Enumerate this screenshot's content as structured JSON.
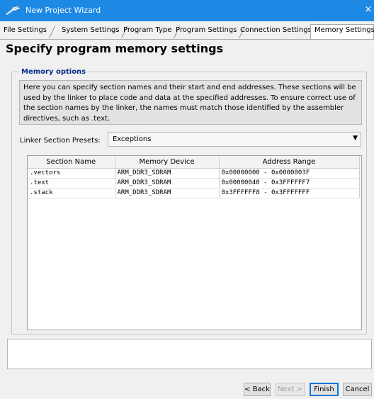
{
  "window": {
    "title": "New Project Wizard",
    "close_glyph": "×",
    "icon": "eclipse-wand-icon"
  },
  "tabs": [
    {
      "label": "File Settings",
      "active": false
    },
    {
      "label": "System Settings",
      "active": false
    },
    {
      "label": "Program Type",
      "active": false
    },
    {
      "label": "Program Settings",
      "active": false
    },
    {
      "label": "Connection Settings",
      "active": false
    },
    {
      "label": "Memory Settings",
      "active": true
    }
  ],
  "page": {
    "title": "Specify program memory settings"
  },
  "memory_options": {
    "legend": "Memory options",
    "description": "Here you can specify section names and their start and end addresses. These sections will be used by the linker to place code and data at the specified addresses. To ensure correct use of the section names by the linker, the names must match those identified by the assembler directives, such as .text.",
    "presets_label": "Linker Section Presets:",
    "presets_value": "Exceptions"
  },
  "table": {
    "columns": [
      "Section Name",
      "Memory Device",
      "Address Range"
    ],
    "rows": [
      {
        "section": ".vectors",
        "device": "ARM_DDR3_SDRAM",
        "range": "0x00000000 - 0x0000003F"
      },
      {
        "section": ".text",
        "device": "ARM_DDR3_SDRAM",
        "range": "0x00000040 - 0x3FFFFFF7"
      },
      {
        "section": ".stack",
        "device": "ARM_DDR3_SDRAM",
        "range": "0x3FFFFFF8 - 0x3FFFFFFF"
      }
    ]
  },
  "buttons": {
    "back": "< Back",
    "next": "Next >",
    "finish": "Finish",
    "cancel": "Cancel"
  },
  "colors": {
    "titlebar": "#1e88e5",
    "legend": "#0b2d8a",
    "default_button_border": "#0078d7"
  }
}
